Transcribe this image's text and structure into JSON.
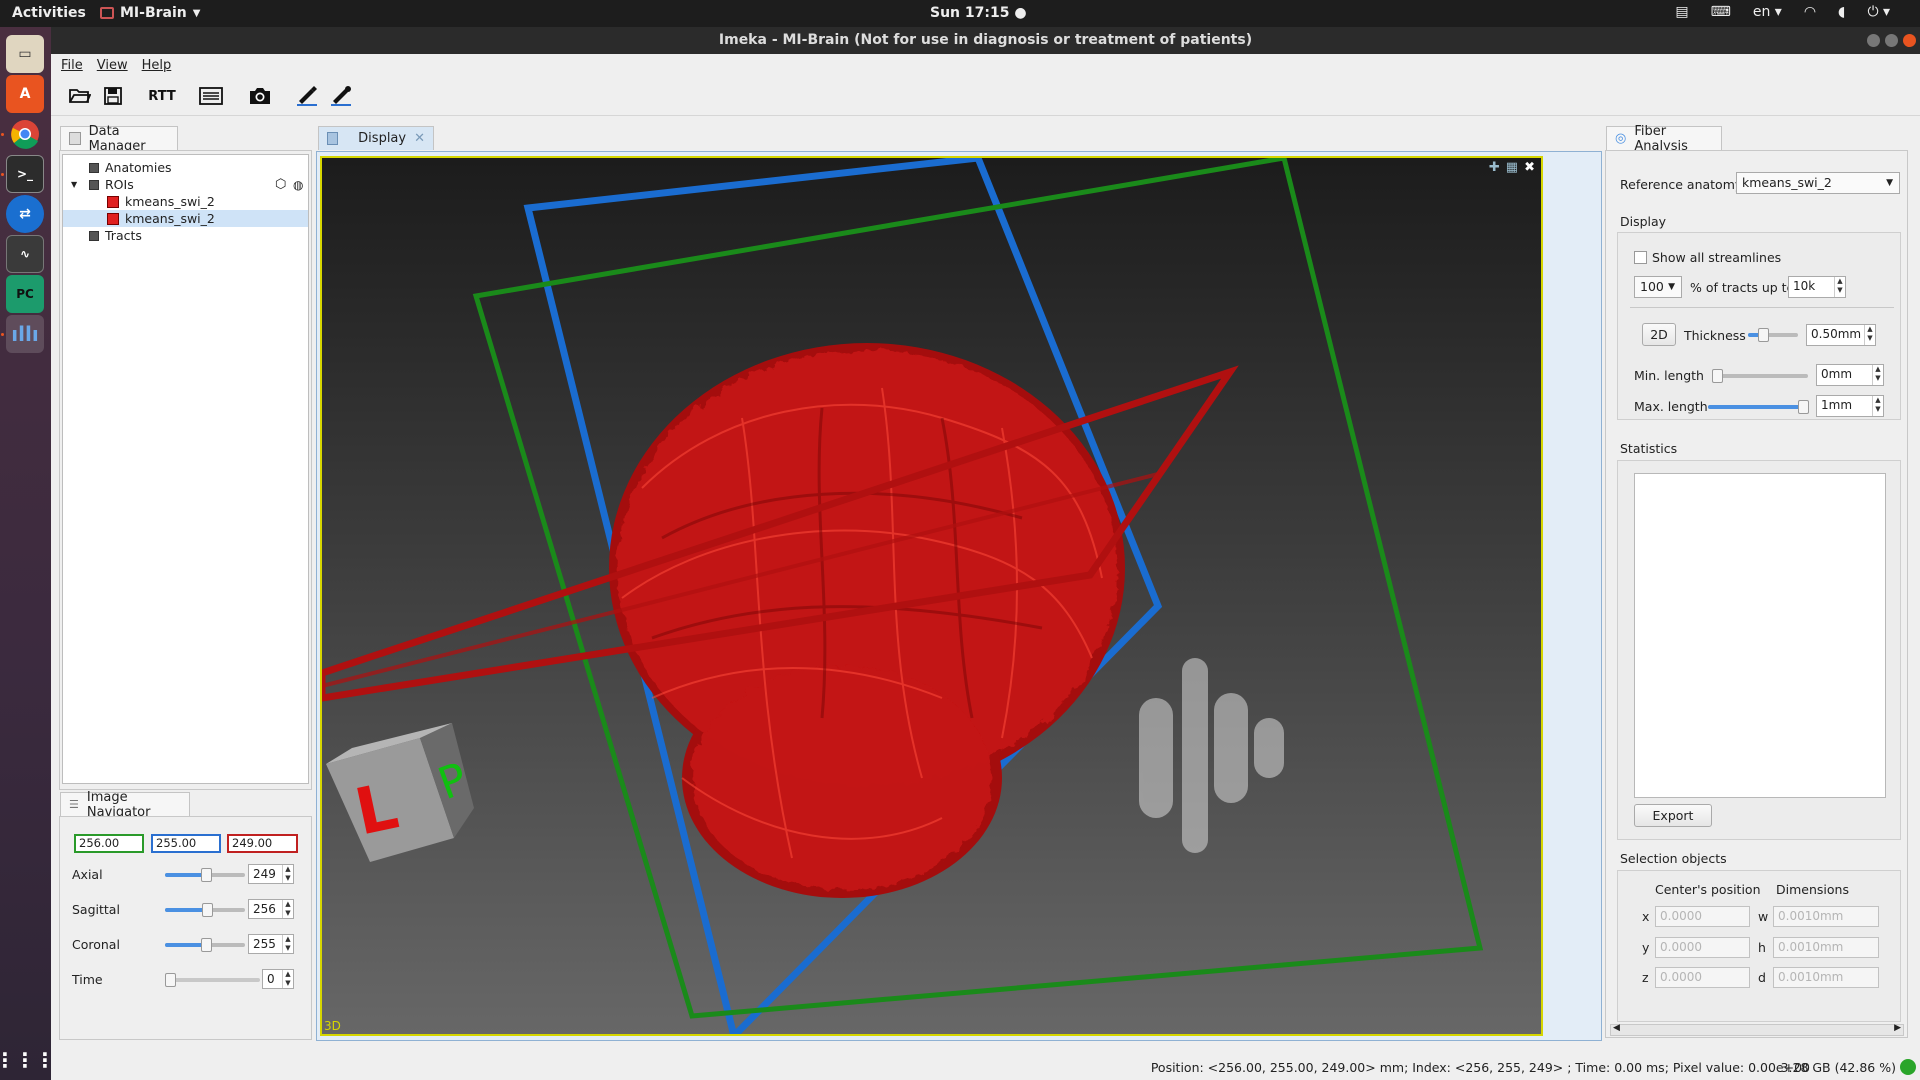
{
  "topbar": {
    "activities": "Activities",
    "app_name": "MI-Brain",
    "clock": "Sun 17:15 ●",
    "lang": "en"
  },
  "window": {
    "title": "Imeka - MI-Brain (Not for use in diagnosis or treatment of patients)"
  },
  "menu": {
    "file": "File",
    "view": "View",
    "help": "Help"
  },
  "toolbar": {
    "rtt_label": "RTT"
  },
  "data_manager": {
    "tab": "Data Manager",
    "items": {
      "anatomies": "Anatomies",
      "rois": "ROIs",
      "roi_1": "kmeans_swi_2",
      "roi_2": "kmeans_swi_2",
      "tracts": "Tracts"
    }
  },
  "navigator": {
    "tab": "Image Navigator",
    "coords": {
      "x": "256.00",
      "y": "255.00",
      "z": "249.00"
    },
    "axial": {
      "label": "Axial",
      "value": "249"
    },
    "sagittal": {
      "label": "Sagittal",
      "value": "256"
    },
    "coronal": {
      "label": "Coronal",
      "value": "255"
    },
    "time": {
      "label": "Time",
      "value": "0"
    }
  },
  "display": {
    "tab": "Display",
    "view_label": "3D",
    "cube": {
      "left": "L",
      "posterior": "P"
    }
  },
  "fiber_analysis": {
    "tab": "Fiber Analysis",
    "ref_anatomy_label": "Reference anatomy",
    "ref_anatomy_value": "kmeans_swi_2",
    "display_title": "Display",
    "show_all_label": "Show all streamlines",
    "percent_value": "100",
    "percent_text": "% of tracts up to",
    "tracts_limit": "10k",
    "btn_2d": "2D",
    "thickness_label": "Thickness",
    "thickness_value": "0.50mm",
    "min_length_label": "Min. length",
    "min_length_value": "0mm",
    "max_length_label": "Max. length",
    "max_length_value": "1mm",
    "statistics_title": "Statistics",
    "export_label": "Export",
    "selection_title": "Selection objects",
    "center_header": "Center's position",
    "dims_header": "Dimensions",
    "x_label": "x",
    "y_label": "y",
    "z_label": "z",
    "w_label": "w",
    "h_label": "h",
    "d_label": "d",
    "pos_x": "0.0000",
    "pos_y": "0.0000",
    "pos_z": "0.0000",
    "dim_w": "0.0010mm",
    "dim_h": "0.0010mm",
    "dim_d": "0.0010mm"
  },
  "status": {
    "text": "Position: <256.00, 255.00, 249.00> mm; Index: <256, 255, 249> ; Time: 0.00 ms; Pixel value: 0.00e+00",
    "memory": "3.28 GB (42.86 %)"
  },
  "colors": {
    "axial_frame": "#b01010",
    "sagittal_frame": "#1a8a1a",
    "coronal_frame": "#1a6cd0",
    "roi": "#d01515",
    "highlight": "#cfe3f7"
  }
}
